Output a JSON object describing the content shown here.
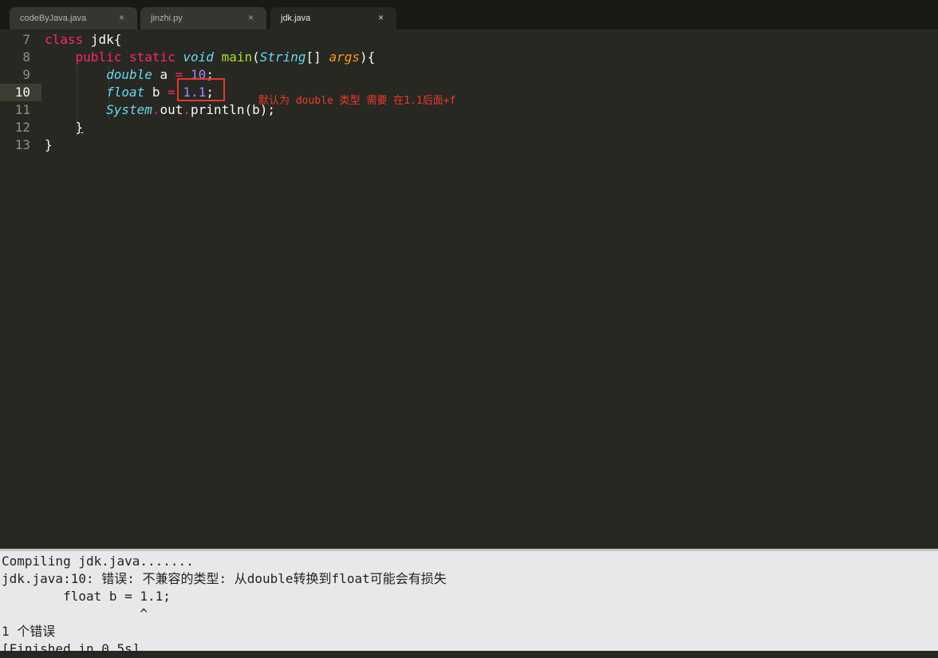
{
  "tabs": [
    {
      "label": "codeByJava.java",
      "close": "×"
    },
    {
      "label": "jinzhi.py",
      "close": "×"
    },
    {
      "label": "jdk.java",
      "close": "×",
      "active": true
    }
  ],
  "editor": {
    "line_numbers": [
      "7",
      "8",
      "9",
      "10",
      "11",
      "12",
      "13"
    ],
    "current_line": "10",
    "lines": {
      "l7": {
        "kw": "class",
        "name": " jdk{"
      },
      "l8": {
        "kw1": "public",
        "kw2": "static",
        "type": "void",
        "fn": "main",
        "open": "(",
        "ptype": "String",
        "brk": "[] ",
        "arg": "args",
        "close": "){"
      },
      "l9": {
        "type": "double",
        "name": " a ",
        "op": "=",
        "num": "10",
        "end": ";"
      },
      "l10": {
        "type": "float",
        "name": " b ",
        "op": "=",
        "num": "1.1",
        "end": ";"
      },
      "l11": {
        "type": "System",
        "dot1": ".",
        "field": "out",
        "dot2": ".",
        "call": "println(b);"
      },
      "l12": {
        "brace": "}"
      },
      "l13": {
        "brace": "}"
      }
    },
    "annotation": "默认为 double 类型 需要 在1.1后面+f"
  },
  "output": {
    "lines": [
      "Compiling jdk.java.......",
      "jdk.java:10: 错误: 不兼容的类型: 从double转换到float可能会有损失",
      "        float b = 1.1;",
      "                  ^",
      "1 个错误",
      "[Finished in 0.5s]"
    ]
  },
  "colors": {
    "background": "#272822",
    "keyword": "#f92672",
    "type": "#66d9ef",
    "function": "#a6e22e",
    "argument": "#fd971f",
    "number": "#ae81ff",
    "annotation": "#f03a2a"
  }
}
